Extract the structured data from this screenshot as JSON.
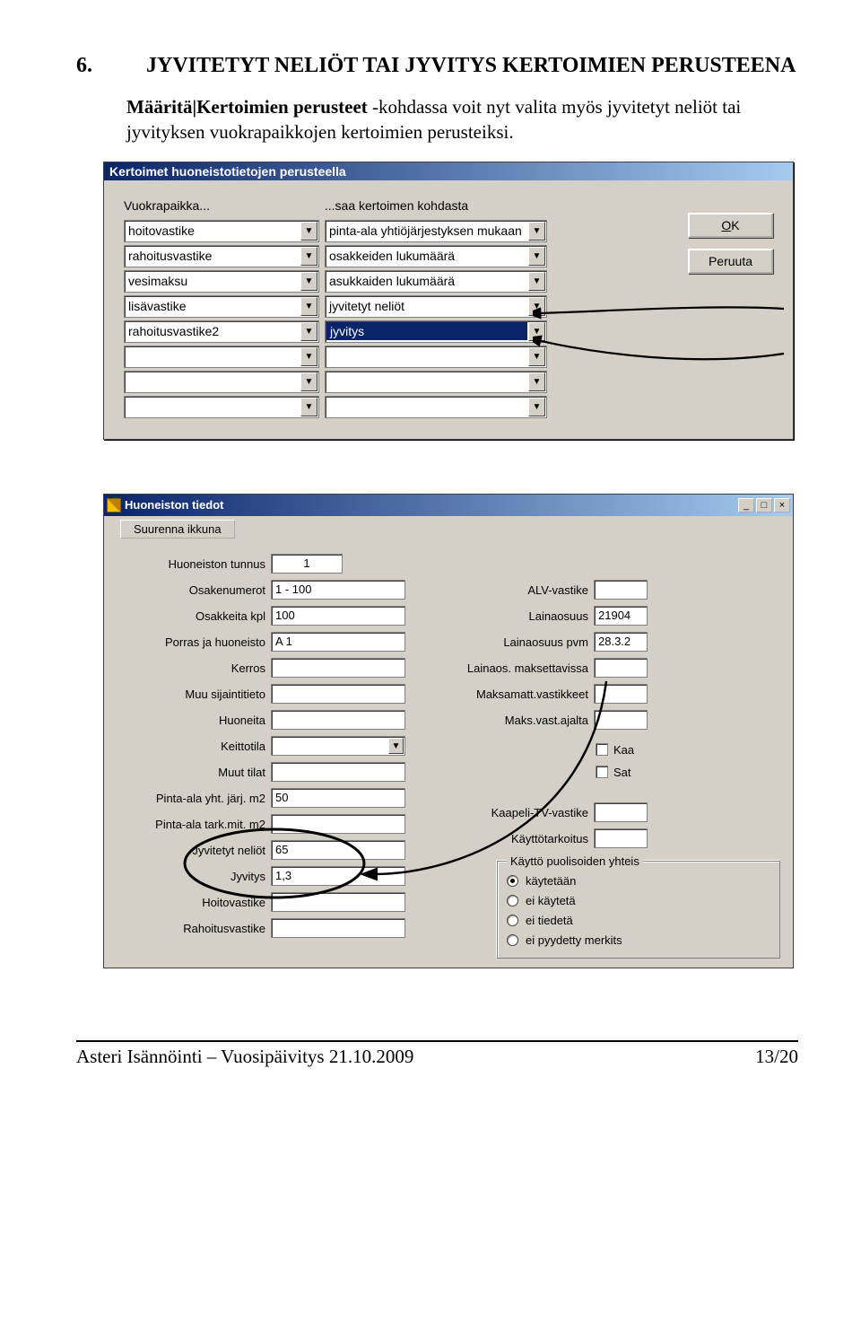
{
  "section": {
    "num": "6.",
    "title": "JYVITETYT NELIÖT TAI JYVITYS  KERTOIMIEN PERUSTEENA"
  },
  "para": {
    "boldpath": "Määritä|Kertoimien perusteet",
    "rest": " -kohdassa voit nyt valita myös jyvitetyt neliöt tai jyvityksen vuokrapaikkojen kertoimien perusteiksi."
  },
  "dlg1": {
    "title": "Kertoimet huoneistotietojen perusteella",
    "label_left": "Vuokrapaikka...",
    "label_right": "...saa kertoimen kohdasta",
    "rows": [
      {
        "l": "hoitovastike",
        "r": "pinta-ala yhtiöjärjestyksen mukaan",
        "sel": false
      },
      {
        "l": "rahoitusvastike",
        "r": "osakkeiden lukumäärä",
        "sel": false
      },
      {
        "l": "vesimaksu",
        "r": "asukkaiden lukumäärä",
        "sel": false
      },
      {
        "l": "lisävastike",
        "r": "jyvitetyt neliöt",
        "sel": false
      },
      {
        "l": "rahoitusvastike2",
        "r": "jyvitys",
        "sel": true
      },
      {
        "l": "",
        "r": "",
        "sel": false
      },
      {
        "l": "",
        "r": "",
        "sel": false
      },
      {
        "l": "",
        "r": "",
        "sel": false
      }
    ],
    "ok_u": "O",
    "ok_rest": "K",
    "cancel": "Peruuta"
  },
  "dlg2": {
    "title": "Huoneiston tiedot",
    "suurenna": "Suurenna ikkuna",
    "left": {
      "tunnus_lab": "Huoneiston tunnus",
      "tunnus": "1",
      "osakenum_lab": "Osakenumerot",
      "osakenum": "1 - 100",
      "osakekpl_lab": "Osakkeita kpl",
      "osakekpl": "100",
      "porras_lab": "Porras ja huoneisto",
      "porras": "A 1",
      "kerros_lab": "Kerros",
      "kerros": "",
      "sijainti_lab": "Muu sijaintitieto",
      "sijainti": "",
      "huoneita_lab": "Huoneita",
      "huoneita": "",
      "keittotila_lab": "Keittotila",
      "muuttilat_lab": "Muut tilat",
      "muuttilat": "",
      "pintayht_lab": "Pinta-ala yht. järj. m2",
      "pintayht": "50",
      "pintatark_lab": "Pinta-ala tark.mit. m2",
      "pintatark": "",
      "jyvneliot_lab": "Jyvitetyt neliöt",
      "jyvneliot": "65",
      "jyvitys_lab": "Jyvitys",
      "jyvitys": "1,3",
      "hoitov_lab": "Hoitovastike",
      "hoitov": "",
      "rahoitv_lab": "Rahoitusvastike",
      "rahoitv": ""
    },
    "right": {
      "alv_lab": "ALV-vastike",
      "alv": "",
      "lainaos_lab": "Lainaosuus",
      "lainaos": "21904",
      "lainapvm_lab": "Lainaosuus pvm",
      "lainapvm": "28.3.2",
      "maksett_lab": "Lainaos. maksettavissa",
      "maksett": "",
      "maksamatt_lab": "Maksamatt.vastikkeet",
      "maksamatt": "",
      "maksajalta_lab": "Maks.vast.ajalta",
      "maksajalta": "",
      "chk1": "Kaa",
      "chk2": "Sat",
      "kaapeli_lab": "Kaapeli-TV-vastike",
      "kaytto_lab": "Käyttötarkoitus",
      "grp_title": "Käyttö puolisoiden yhteis",
      "r1": "käytetään",
      "r2": "ei käytetä",
      "r3": "ei tiedetä",
      "r4": "ei pyydetty merkits"
    }
  },
  "footer": {
    "left": "Asteri Isännöinti – Vuosipäivitys 21.10.2009",
    "right": "13/20"
  }
}
